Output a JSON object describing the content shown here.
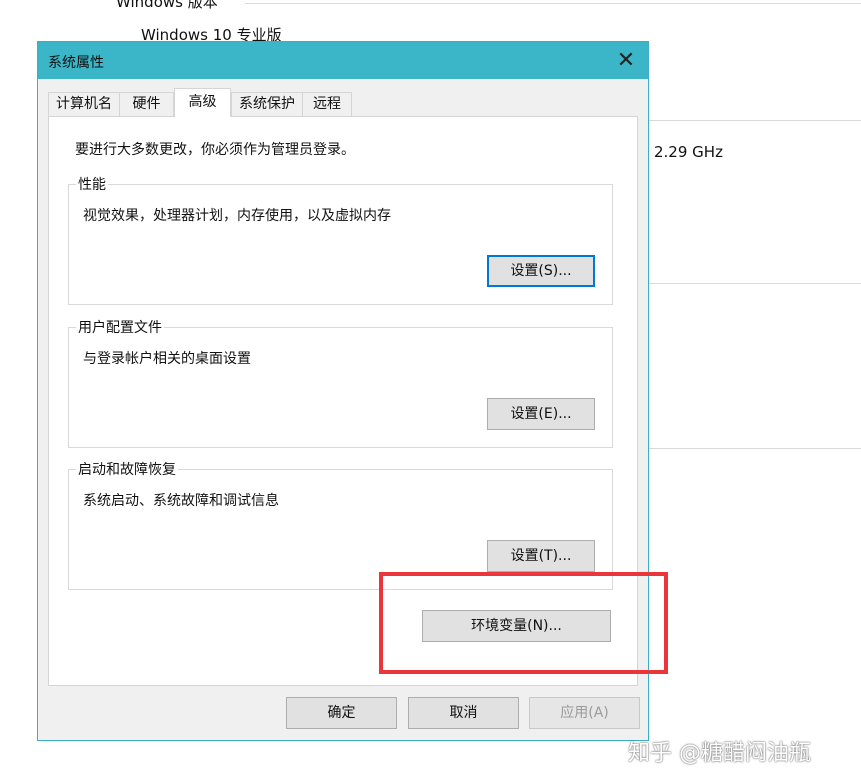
{
  "background_window": {
    "windows_version_label": "Windows 版本",
    "windows_edition": "Windows 10 专业版",
    "cpu_speed": "2.29 GHz"
  },
  "dialog": {
    "title": "系统属性",
    "close_icon": "close-icon",
    "tabs": [
      {
        "label": "计算机名",
        "active": false
      },
      {
        "label": "硬件",
        "active": false
      },
      {
        "label": "高级",
        "active": true
      },
      {
        "label": "系统保护",
        "active": false
      },
      {
        "label": "远程",
        "active": false
      }
    ],
    "notice": "要进行大多数更改，你必须作为管理员登录。",
    "groups": [
      {
        "title": "性能",
        "description": "视觉效果，处理器计划，内存使用，以及虚拟内存",
        "button": "设置(S)..."
      },
      {
        "title": "用户配置文件",
        "description": "与登录帐户相关的桌面设置",
        "button": "设置(E)..."
      },
      {
        "title": "启动和故障恢复",
        "description": "系统启动、系统故障和调试信息",
        "button": "设置(T)..."
      }
    ],
    "env_button": "环境变量(N)...",
    "footer": {
      "ok": "确定",
      "cancel": "取消",
      "apply": "应用(A)"
    }
  },
  "annotation_color": "#e8363a",
  "watermark": "知乎 @糖醋闷油瓶"
}
